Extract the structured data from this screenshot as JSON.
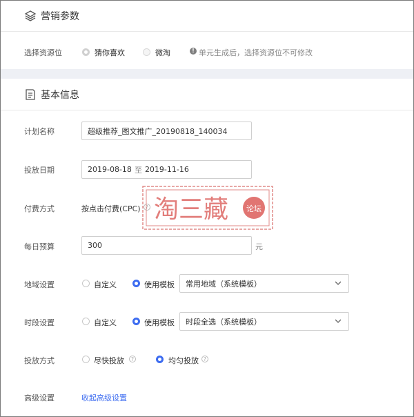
{
  "marketing": {
    "title": "营销参数",
    "resource_label": "选择资源位",
    "options": [
      "猜你喜欢",
      "微淘"
    ],
    "notice": "单元生成后，选择资源位不可修改",
    "notice_icon": "warning-icon"
  },
  "basic": {
    "title": "基本信息",
    "fields": {
      "plan_name_label": "计划名称",
      "plan_name_value": "超级推荐_图文推广_20190818_140034",
      "date_label": "投放日期",
      "date_start": "2019-08-18",
      "date_sep": "至",
      "date_end": "2019-11-16",
      "pay_label": "付费方式",
      "pay_value": "按点击付费(CPC)",
      "budget_label": "每日预算",
      "budget_value": "300",
      "budget_unit": "元",
      "region_label": "地域设置",
      "region_custom": "自定义",
      "region_template": "使用模板",
      "region_select": "常用地域（系统模板）",
      "time_label": "时段设置",
      "time_custom": "自定义",
      "time_template": "使用模板",
      "time_select": "时段全选（系统模板）",
      "delivery_label": "投放方式",
      "delivery_fast": "尽快投放",
      "delivery_even": "均匀投放",
      "advanced_label": "高级设置",
      "advanced_link": "收起高级设置"
    }
  },
  "watermark": {
    "text": "淘三藏",
    "seal_text": "论坛"
  },
  "colors": {
    "accent": "#3d6cf0",
    "band": "#eef0f5",
    "watermark": "#d9534f"
  }
}
